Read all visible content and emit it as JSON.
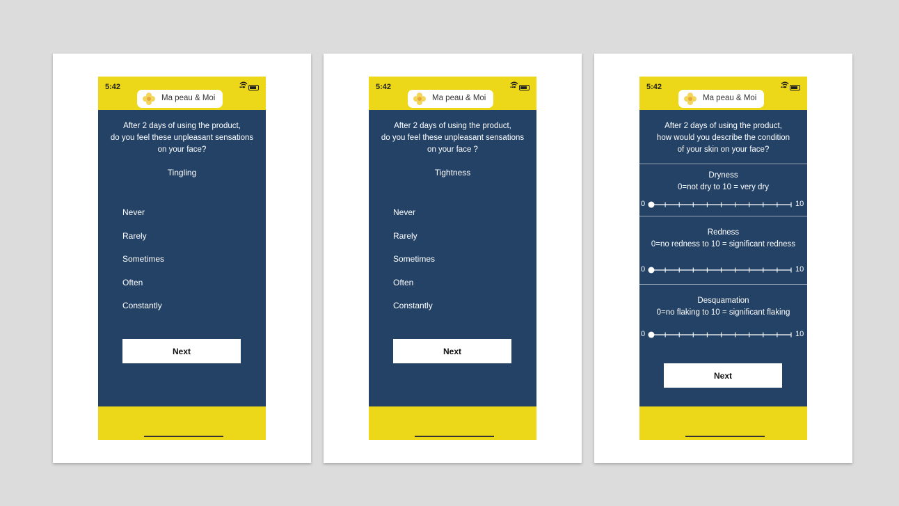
{
  "status_bar": {
    "time": "5:42",
    "signal": "...."
  },
  "brand": {
    "name": "Ma peau & Moi"
  },
  "screens": [
    {
      "question": [
        "After 2 days of using the product,",
        "do you feel these unpleasant sensations",
        "on your face?"
      ],
      "topic": "Tingling",
      "options": [
        "Never",
        "Rarely",
        "Sometimes",
        "Often",
        "Constantly"
      ],
      "next_label": "Next"
    },
    {
      "question": [
        "After 2 days of using the product,",
        "do you feel these unpleasant sensations",
        "on your face ?"
      ],
      "topic": "Tightness",
      "options": [
        "Never",
        "Rarely",
        "Sometimes",
        "Often",
        "Constantly"
      ],
      "next_label": "Next"
    },
    {
      "question": [
        "After 2 days of using the product,",
        "how would you describe the condition",
        "of your skin on your face?"
      ],
      "scales": [
        {
          "title": "Dryness",
          "legend": "0=not dry to 10 = very dry",
          "min_label": "0",
          "max_label": "10",
          "value": 0
        },
        {
          "title": "Redness",
          "legend": "0=no redness to 10 = significant redness",
          "min_label": "0",
          "max_label": "10",
          "value": 0
        },
        {
          "title": "Desquamation",
          "legend": "0=no flaking to 10 = significant flaking",
          "min_label": "0",
          "max_label": "10",
          "value": 0
        }
      ],
      "next_label": "Next"
    }
  ],
  "colors": {
    "background": "#dcdcdc",
    "phone_body": "#234266",
    "accent_yellow": "#ecd818",
    "button": "#ffffff"
  }
}
